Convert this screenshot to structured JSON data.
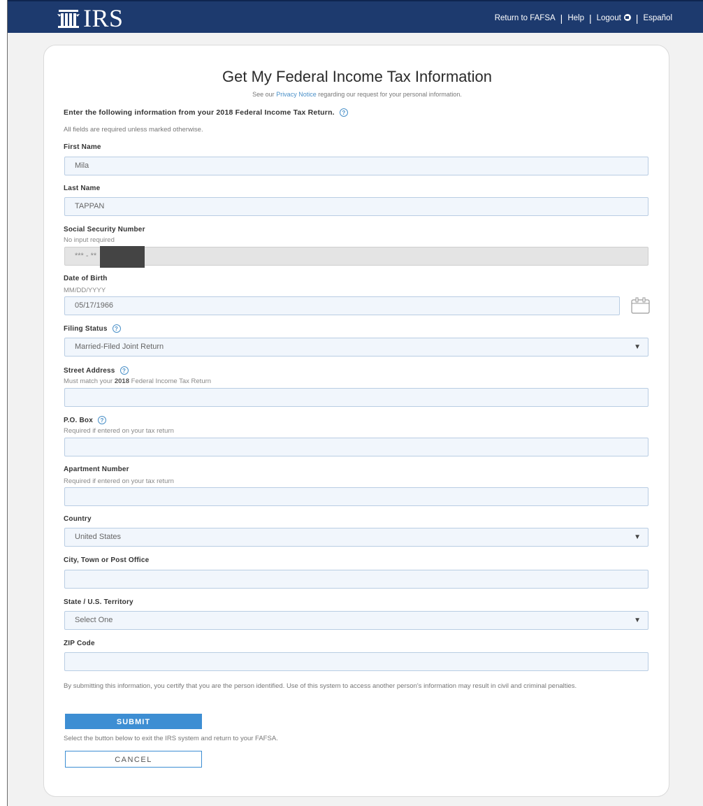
{
  "header": {
    "logo_text": "IRS",
    "nav": {
      "return_fafsa": "Return to FAFSA",
      "help": "Help",
      "logout": "Logout",
      "espanol": "Español",
      "separator": "|"
    },
    "bg_color": "#1d3a6e"
  },
  "page": {
    "title": "Get My Federal Income Tax Information",
    "privacy_prefix": "See our",
    "privacy_link": "Privacy Notice",
    "privacy_suffix": "regarding our request for your personal information.",
    "instruction": "Enter the following information from your 2018 Federal Income Tax Return.",
    "required_note": "All fields are required unless marked otherwise."
  },
  "form": {
    "first_name": {
      "label": "First Name",
      "value": "Mila"
    },
    "last_name": {
      "label": "Last Name",
      "value": "TAPPAN"
    },
    "ssn": {
      "label": "Social Security Number",
      "hint": "No input required",
      "value": "*** - **"
    },
    "dob": {
      "label": "Date of Birth",
      "hint": "MM/DD/YYYY",
      "value": "05/17/1966"
    },
    "filing_status": {
      "label": "Filing Status",
      "value": "Married-Filed Joint Return"
    },
    "street": {
      "label": "Street Address",
      "hint_prefix": "Must match your",
      "hint_year": "2018",
      "hint_suffix": "Federal Income Tax Return",
      "value": ""
    },
    "po_box": {
      "label": "P.O. Box",
      "hint": "Required if entered on your tax return",
      "value": ""
    },
    "apartment": {
      "label": "Apartment Number",
      "hint": "Required if entered on your tax return",
      "value": ""
    },
    "country": {
      "label": "Country",
      "value": "United States"
    },
    "city": {
      "label": "City, Town or Post Office",
      "value": ""
    },
    "state": {
      "label": "State / U.S. Territory",
      "value": "Select One"
    },
    "zip": {
      "label": "ZIP Code",
      "value": ""
    },
    "help_glyph": "?",
    "dropdown_glyph": "▼"
  },
  "footer": {
    "disclaimer": "By submitting this information, you certify that you are the person identified. Use of this system to access another person's information may result in civil and criminal penalties.",
    "submit_label": "SUBMIT",
    "exit_note": "Select the button below to exit the IRS system and return to your FAFSA.",
    "cancel_label": "CANCEL"
  },
  "colors": {
    "accent": "#3d8ed3",
    "field_bg": "#f1f6fc",
    "field_border": "#b9cde3"
  }
}
